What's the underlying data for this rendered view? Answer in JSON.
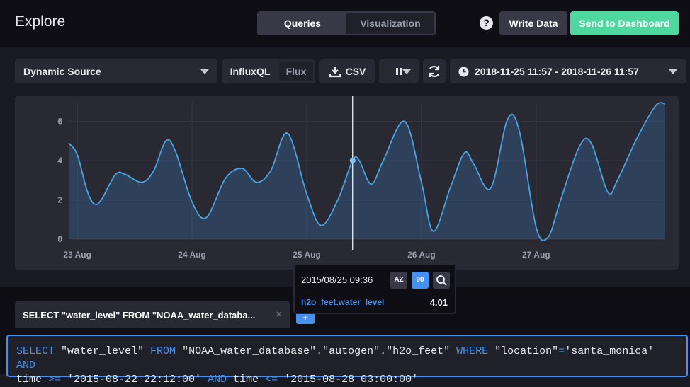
{
  "header": {
    "title": "Explore",
    "tabs": [
      "Queries",
      "Visualization"
    ],
    "active_tab": "Queries",
    "help_label": "?",
    "write_label": "Write Data",
    "send_label": "Send to Dashboard"
  },
  "toolbar": {
    "source": "Dynamic Source",
    "lang_influx": "InfluxQL",
    "lang_flux": "Flux",
    "csv_label": "CSV",
    "pause_label": "II",
    "time_range": "2018-11-25 11:57 - 2018-11-26 11:57"
  },
  "chart_data": {
    "type": "area",
    "series": [
      {
        "name": "h2o_feet.water_level",
        "x": [
          "2015-08-22 22:12",
          "2015-08-23 00:00",
          "2015-08-23 02:00",
          "2015-08-23 03:30",
          "2015-08-23 05:00",
          "2015-08-23 08:00",
          "2015-08-23 10:00",
          "2015-08-23 13:30",
          "2015-08-23 16:00",
          "2015-08-23 18:30",
          "2015-08-23 20:30",
          "2015-08-24 00:00",
          "2015-08-24 03:00",
          "2015-08-24 07:00",
          "2015-08-24 10:30",
          "2015-08-24 13:30",
          "2015-08-24 16:30",
          "2015-08-24 20:00",
          "2015-08-25 00:00",
          "2015-08-25 03:00",
          "2015-08-25 06:30",
          "2015-08-25 09:36",
          "2015-08-25 11:00",
          "2015-08-25 13:30",
          "2015-08-25 16:00",
          "2015-08-25 20:30",
          "2015-08-26 00:00",
          "2015-08-26 02:30",
          "2015-08-26 06:00",
          "2015-08-26 09:00",
          "2015-08-26 11:00",
          "2015-08-26 14:30",
          "2015-08-26 18:00",
          "2015-08-26 20:30",
          "2015-08-27 00:00",
          "2015-08-27 02:30",
          "2015-08-27 05:00",
          "2015-08-27 09:00",
          "2015-08-27 11:30",
          "2015-08-27 15:00",
          "2015-08-27 17:00",
          "2015-08-27 21:00",
          "2015-08-28 01:00",
          "2015-08-28 03:00"
        ],
        "values": [
          4.9,
          4.3,
          2.5,
          1.8,
          2.0,
          3.3,
          3.3,
          2.9,
          3.5,
          5.0,
          4.5,
          1.9,
          1.1,
          3.1,
          3.6,
          2.9,
          3.5,
          5.4,
          2.3,
          0.7,
          2.0,
          4.01,
          4.0,
          2.8,
          4.0,
          6.0,
          2.9,
          0.4,
          2.6,
          4.4,
          3.8,
          2.6,
          6.1,
          5.5,
          0.6,
          0.1,
          1.9,
          4.7,
          4.9,
          2.4,
          3.0,
          5.1,
          6.8,
          6.9
        ]
      }
    ],
    "x_ticks": [
      "23 Aug",
      "24 Aug",
      "25 Aug",
      "26 Aug",
      "27 Aug"
    ],
    "y_ticks": [
      "0",
      "2",
      "4",
      "6"
    ],
    "ylim": [
      0,
      7
    ],
    "grid": true,
    "title": "",
    "xlabel": "",
    "ylabel": ""
  },
  "tooltip": {
    "time": "2015/08/25 09:36",
    "sort_az": "AZ",
    "sort_09": "90",
    "series_name": "h2o_feet.water_level",
    "value": "4.01"
  },
  "query": {
    "tab_label": "SELECT \"water_level\" FROM \"NOAA_water_databa...",
    "close_label": "×",
    "add_label": "+",
    "line1": [
      "SELECT",
      " \"water_level\" ",
      "FROM",
      " \"NOAA_water_database\".\"autogen\".\"h2o_feet\" ",
      "WHERE",
      " \"location\"",
      "=",
      "'santa_monica' ",
      "AND"
    ],
    "line2": [
      "time ",
      ">=",
      " '2015-08-22 22:12:00' ",
      "AND",
      " time ",
      "<=",
      " '2015-08-28 03:00:00'"
    ]
  },
  "colors": {
    "accent": "#4591ed",
    "send": "#4ed8a0",
    "line": "#4aa3e0"
  }
}
